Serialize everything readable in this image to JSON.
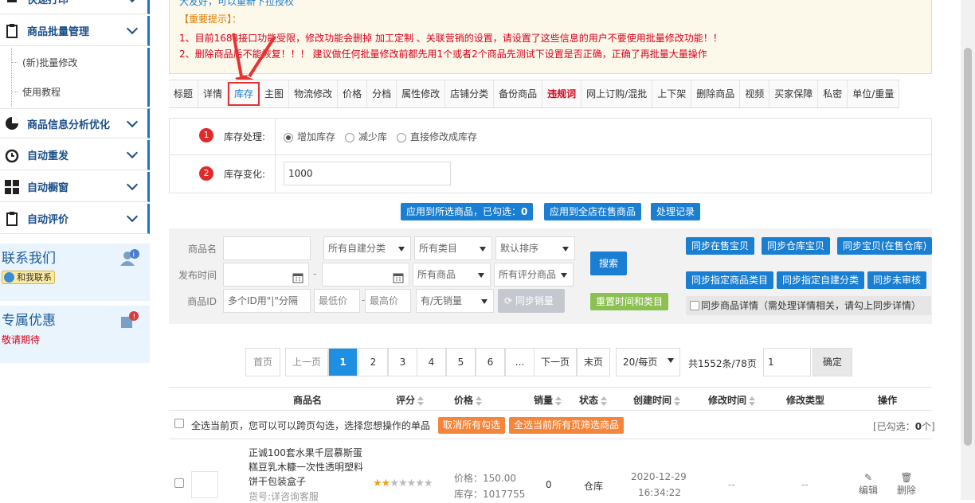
{
  "sidebar": {
    "top_item": "快递打印",
    "batch_menu": "商品批量管理",
    "sub_items": [
      "(新)批量修改",
      "使用教程"
    ],
    "menus": [
      "商品信息分析优化",
      "自动重发",
      "自动橱窗",
      "自动评价"
    ],
    "contact_title": "联系我们",
    "contact_btn": "和我联系",
    "promo_title": "专属优惠",
    "promo_text": "敬请期待"
  },
  "notice": {
    "line0": "大友好，可以重新下拉授权",
    "title": "【重要提示】：",
    "line1": "1、目前1688接口功能受限，修改功能会删掉 加工定制 、关联营销的设置，请设置了这些信息的用户不要使用批量修改功能！！",
    "line2": "2、删除商品后不能恢复！！！ 建议做任何批量修改前都先用1个或者2个商品先测试下设置是否正确，正确了再批量大量操作"
  },
  "tabs": [
    "标题",
    "详情",
    "库存",
    "主图",
    "物流修改",
    "价格",
    "分档",
    "属性修改",
    "店铺分类",
    "备份商品",
    "违规词",
    "网上订购/混批",
    "上下架",
    "删除商品",
    "视频",
    "买家保障",
    "私密",
    "单位/重量"
  ],
  "form": {
    "step1": "1",
    "label1": "库存处理:",
    "options": [
      "增加库存",
      "减少库",
      "直接修改成库存"
    ],
    "step2": "2",
    "label2": "库存变化:",
    "stock_value": "1000"
  },
  "actions": {
    "apply_selected": "应用到所选商品，已勾选：",
    "selected_count": "0",
    "apply_all": "应用到全店在售商品",
    "records": "处理记录"
  },
  "search": {
    "label_name": "商品名",
    "label_time": "发布时间",
    "label_id": "商品ID",
    "category": "所有自建分类",
    "type": "所有类目",
    "sort": "默认排序",
    "goods": "所有商品",
    "rating": "所有评分商品",
    "id_placeholder": "多个ID用\"|\"分隔",
    "min_price": "最低价",
    "max_price": "最高价",
    "sales": "有/无销量",
    "sync_sales": "同步销量",
    "search_btn": "搜索",
    "reset_btn": "重置时间和类目",
    "sync_onsale": "同步在售宝贝",
    "sync_warehouse": "同步仓库宝贝",
    "sync_onsale_wh": "同步宝贝(在售仓库)",
    "sync_type": "同步指定商品类目",
    "sync_custom": "同步指定自建分类",
    "sync_unreviewed": "同步未审核",
    "sync_detail": "同步商品详情（需处理详情相关，请勾上同步详情）"
  },
  "pager": {
    "first": "首页",
    "prev": "上一页",
    "pages": [
      "1",
      "2",
      "3",
      "4",
      "5",
      "6",
      "..."
    ],
    "next": "下一页",
    "last": "末页",
    "per_page": "20/每页",
    "total": "共1552条/78页",
    "goto_value": "1",
    "confirm": "确定"
  },
  "table": {
    "headers": [
      "商品名",
      "评分",
      "价格",
      "销量",
      "状态",
      "创建时间",
      "修改时间",
      "修改类型",
      "操作"
    ],
    "select_page": "全选当前页，您可以可以跨页勾选，选择您想操作的单品",
    "cancel_all": "取消所有勾选",
    "select_all_filtered": "全选当前所有页筛选商品",
    "checked_label": "[已勾选：",
    "checked_count": "0",
    "checked_suffix": "个]",
    "row": {
      "name": "正诚100套水果千层慕斯蛋糕豆乳木糠一次性透明塑料饼干包装盒子",
      "code": "货号:详咨询客服",
      "rating": 2,
      "price": "价格：150.00",
      "stock": "库存：1017755",
      "sales": "0",
      "status": "仓库",
      "date": "2020-12-29",
      "time": "16:34:22",
      "modified": "--",
      "mod_type": "--",
      "edit": "编辑",
      "delete": "删除"
    }
  },
  "colors": {
    "blue": "#1a7fd3",
    "orange": "#f5853a",
    "green": "#8cc152",
    "red": "#e53333"
  }
}
